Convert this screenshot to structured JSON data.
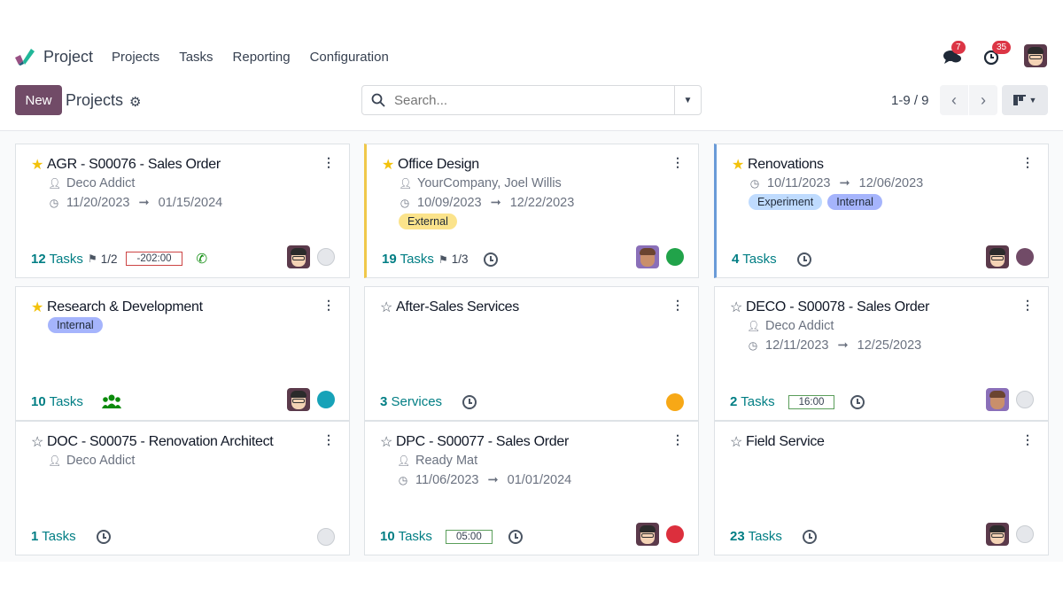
{
  "navbar": {
    "app_name": "Project",
    "menu": [
      "Projects",
      "Tasks",
      "Reporting",
      "Configuration"
    ],
    "messages_badge": "7",
    "activities_badge": "35"
  },
  "control": {
    "new_label": "New",
    "title": "Projects",
    "search_placeholder": "Search...",
    "pager": "1-9 / 9"
  },
  "colors": {
    "brand": "#714b67",
    "accent": "#017e84"
  },
  "projects": [
    {
      "name": "AGR - S00076 - Sales Order",
      "favorite": true,
      "customer": "Deco Addict",
      "date_start": "11/20/2023",
      "date_end": "01/15/2024",
      "tags": [],
      "count": "12",
      "count_label": "Tasks",
      "milestone": "1/2",
      "time": "-202:00",
      "activity": "phone",
      "status": "grey"
    },
    {
      "name": "Office Design",
      "favorite": true,
      "customer": "YourCompany, Joel Willis",
      "date_start": "10/09/2023",
      "date_end": "12/22/2023",
      "tags": [
        "External"
      ],
      "count": "19",
      "count_label": "Tasks",
      "milestone": "1/3",
      "activity": "clock",
      "status": "green"
    },
    {
      "name": "Renovations",
      "favorite": true,
      "date_start": "10/11/2023",
      "date_end": "12/06/2023",
      "tags": [
        "Experiment",
        "Internal"
      ],
      "count": "4",
      "count_label": "Tasks",
      "activity": "clock",
      "status": "purple"
    },
    {
      "name": "Research & Development",
      "favorite": true,
      "tags": [
        "Internal"
      ],
      "count": "10",
      "count_label": "Tasks",
      "activity": "users",
      "status": "teal"
    },
    {
      "name": "After-Sales Services",
      "favorite": false,
      "tags": [],
      "count": "3",
      "count_label": "Services",
      "activity": "clock",
      "status": "orange"
    },
    {
      "name": "DECO - S00078 - Sales Order",
      "favorite": false,
      "customer": "Deco Addict",
      "date_start": "12/11/2023",
      "date_end": "12/25/2023",
      "tags": [],
      "count": "2",
      "count_label": "Tasks",
      "time": "16:00",
      "activity": "clock",
      "status": "grey"
    },
    {
      "name": "DOC - S00075 - Renovation Architect",
      "favorite": false,
      "customer": "Deco Addict",
      "tags": [],
      "count": "1",
      "count_label": "Tasks",
      "activity": "clock",
      "status": "grey"
    },
    {
      "name": "DPC - S00077 - Sales Order",
      "favorite": false,
      "customer": "Ready Mat",
      "date_start": "11/06/2023",
      "date_end": "01/01/2024",
      "tags": [],
      "count": "10",
      "count_label": "Tasks",
      "time": "05:00",
      "activity": "clock",
      "status": "red"
    },
    {
      "name": "Field Service",
      "favorite": false,
      "tags": [],
      "count": "23",
      "count_label": "Tasks",
      "activity": "clock",
      "status": "grey"
    }
  ]
}
